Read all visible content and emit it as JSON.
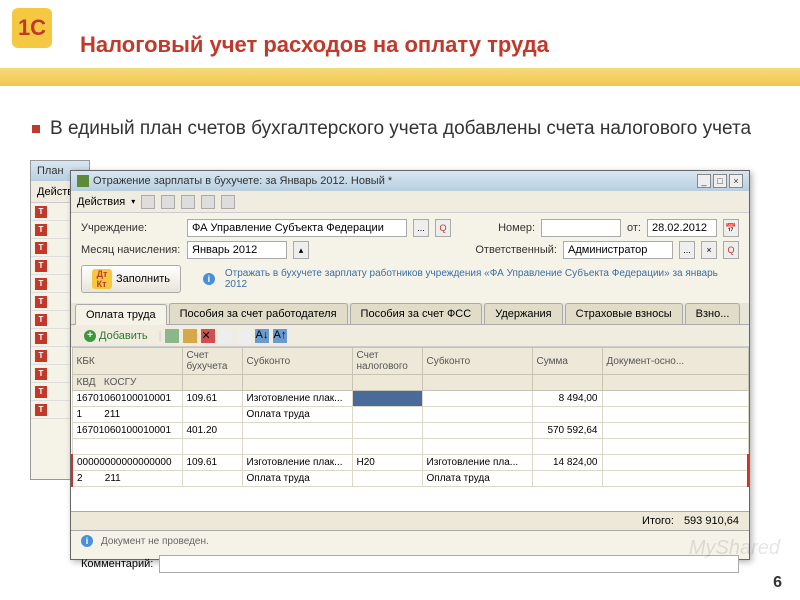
{
  "slide": {
    "title": "Налоговый учет расходов на оплату труда",
    "bullet": "В единый план счетов бухгалтерского учета добавлены счета налогового учета",
    "page_num": "6",
    "watermark": "MyShared"
  },
  "win1": {
    "label": "План",
    "menu": "Действия"
  },
  "win2": {
    "title": "Отражение зарплаты в бухучете: за Январь 2012. Новый *",
    "menu": "Действия",
    "form": {
      "org_label": "Учреждение:",
      "org_value": "ФА Управление Субъекта Федерации",
      "month_label": "Месяц начисления:",
      "month_value": "Январь 2012",
      "num_label": "Номер:",
      "num_value": "",
      "date_label": "от:",
      "date_value": "28.02.2012",
      "resp_label": "Ответственный:",
      "resp_value": "Администратор"
    },
    "fill_label": "Заполнить",
    "info_text": "Отражать в бухучете зарплату работников учреждения «ФА Управление Субъекта Федерации» за январь 2012",
    "tabs": [
      "Оплата труда",
      "Пособия за счет работодателя",
      "Пособия за счет ФСС",
      "Удержания",
      "Страховые взносы",
      "Взно..."
    ],
    "add_label": "Добавить",
    "headers": {
      "kbk": "КБК",
      "kvd": "КВД",
      "kosgu": "КОСГУ",
      "acct": "Счет бухучета",
      "sub": "Субконто",
      "taxacct": "Счет налогового",
      "taxsub": "Субконто",
      "sum": "Сумма",
      "doc": "Документ-осно..."
    },
    "rows": [
      {
        "kbk": "16701060100010001",
        "kvd": "1",
        "kosgu": "211",
        "acct": "109.61",
        "sub1": "Изготовление плак...",
        "sub2": "Оплата труда",
        "taxacct": "",
        "taxsub1": "",
        "taxsub2": "",
        "sum": "8 494,00",
        "doc": ""
      },
      {
        "kbk": "16701060100010001",
        "kvd": "",
        "kosgu": "",
        "acct": "401.20",
        "sub1": "",
        "sub2": "",
        "taxacct": "",
        "taxsub1": "",
        "taxsub2": "",
        "sum": "570 592,64",
        "doc": ""
      },
      {
        "kbk": "00000000000000000",
        "kvd": "2",
        "kosgu": "211",
        "acct": "109.61",
        "sub1": "Изготовление плак...",
        "sub2": "Оплата труда",
        "taxacct": "Н20",
        "taxsub1": "Изготовление пла...",
        "taxsub2": "Оплата труда",
        "sum": "14 824,00",
        "doc": ""
      }
    ],
    "total_label": "Итого:",
    "total_value": "593 910,64",
    "status": "Документ не проведен.",
    "comment_label": "Комментарий:"
  }
}
